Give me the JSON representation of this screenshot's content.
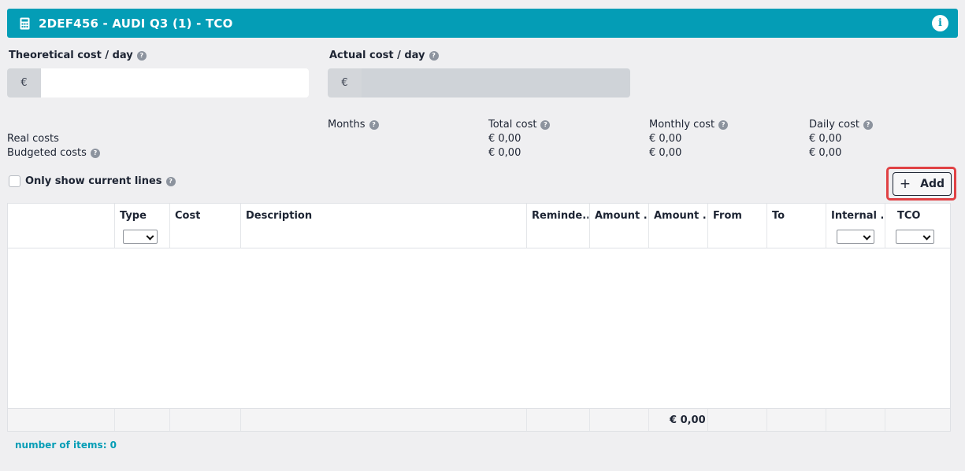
{
  "header": {
    "title": "2DEF456 - AUDI Q3 (1) - TCO",
    "icon": "calculator-icon",
    "info_icon": "info-icon",
    "color": "#049db6"
  },
  "theoretical": {
    "label": "Theoretical cost / day",
    "prefix": "€",
    "value": ""
  },
  "actual": {
    "label": "Actual cost / day",
    "prefix": "€",
    "value": ""
  },
  "summary": {
    "headers": {
      "months": "Months",
      "total": "Total cost",
      "monthly": "Monthly cost",
      "daily": "Daily cost"
    },
    "rows": [
      {
        "label": "Real costs",
        "total": "€ 0,00",
        "monthly": "€ 0,00",
        "daily": "€ 0,00"
      },
      {
        "label": "Budgeted costs",
        "total": "€ 0,00",
        "monthly": "€ 0,00",
        "daily": "€ 0,00"
      }
    ]
  },
  "filter": {
    "only_current_label": "Only show current lines",
    "checked": false
  },
  "add_button": {
    "label": "Add",
    "icon": "plus-icon"
  },
  "table": {
    "columns": [
      "",
      "Type",
      "Cost",
      "Description",
      "Reminde...",
      "Amount ...",
      "Amount ...",
      "From",
      "To",
      "Internal ...",
      "TCO"
    ],
    "footer_total": "€ 0,00",
    "rows": []
  },
  "footer": {
    "items_count": "number of items: 0"
  }
}
